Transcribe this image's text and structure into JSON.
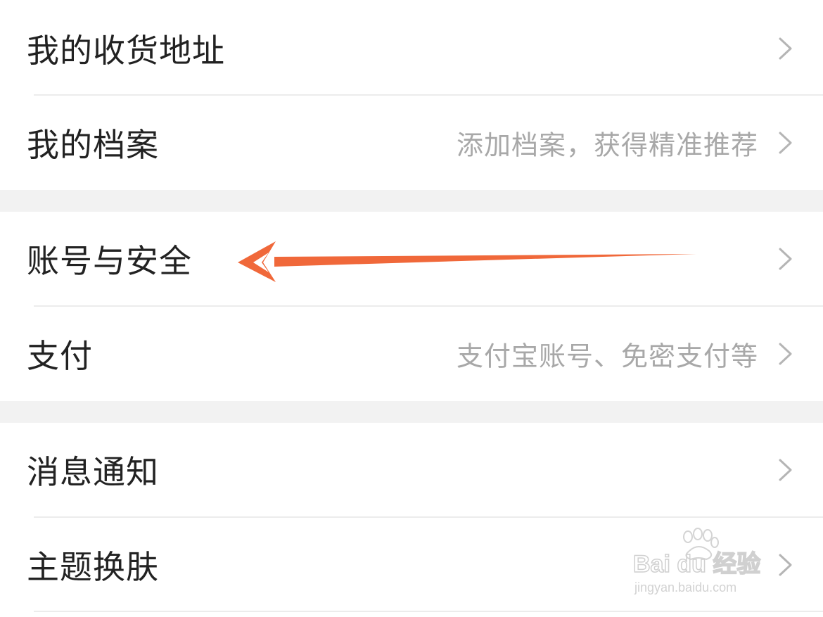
{
  "settings": {
    "shipping_address": {
      "label": "我的收货地址"
    },
    "profile": {
      "label": "我的档案",
      "subtitle": "添加档案，获得精准推荐"
    },
    "account_security": {
      "label": "账号与安全"
    },
    "payment": {
      "label": "支付",
      "subtitle": "支付宝账号、免密支付等"
    },
    "notifications": {
      "label": "消息通知"
    },
    "theme": {
      "label": "主题换肤"
    }
  },
  "annotation": {
    "arrow_color": "#f0683a"
  },
  "watermark": {
    "line1": "Bai du 经验",
    "line2": "jingyan.baidu.com"
  },
  "colors": {
    "label_text": "#222222",
    "subtitle_text": "#a8a8a8",
    "chevron": "#b5b5b5",
    "section_gap": "#f2f2f2",
    "divider": "#ececec"
  }
}
